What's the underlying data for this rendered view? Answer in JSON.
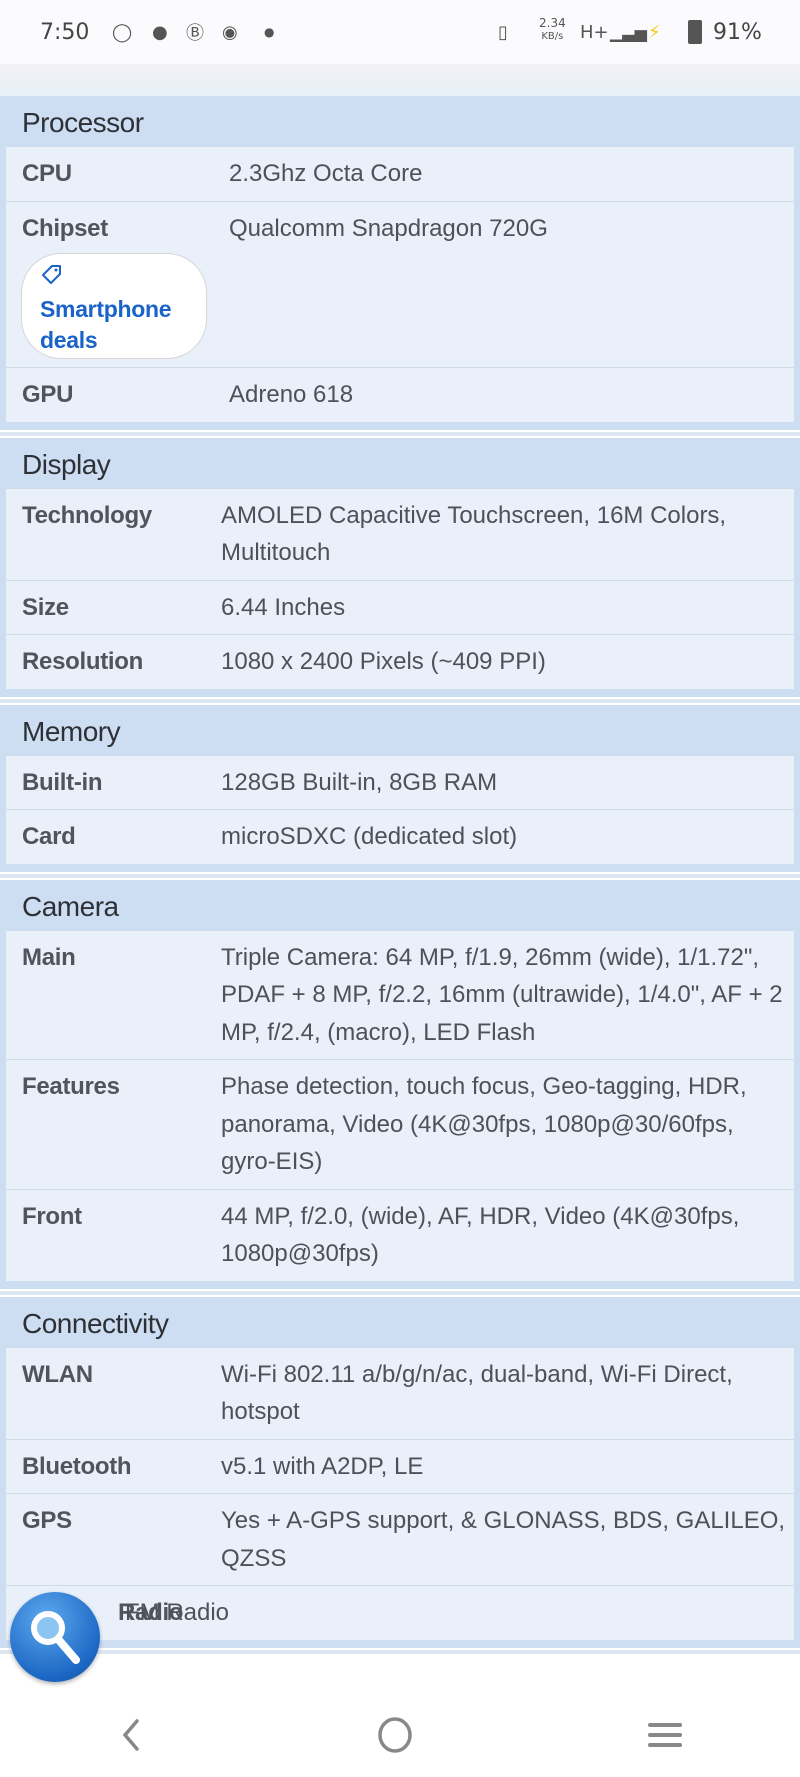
{
  "status_bar": {
    "time": "7:50",
    "notification_icons": [
      "whatsapp-icon",
      "messages-icon",
      "whatsapp-business-icon",
      "chrome-icon",
      "dot-icon"
    ],
    "net_speed": "2.34",
    "net_unit": "KB/s",
    "network": "H+",
    "battery": "91%"
  },
  "sections": [
    {
      "title": "Processor",
      "rows": [
        {
          "label": "CPU",
          "value": "2.3Ghz Octa Core"
        },
        {
          "label": "Chipset",
          "value": "Qualcomm Snapdragon 720G"
        },
        {
          "label": "GPU",
          "value": "Adreno 618"
        }
      ]
    },
    {
      "title": "Display",
      "rows": [
        {
          "label": "Technology",
          "value": "AMOLED Capacitive Touchscreen, 16M Colors, Multitouch"
        },
        {
          "label": "Size",
          "value": "6.44 Inches"
        },
        {
          "label": "Resolution",
          "value": "1080 x 2400 Pixels (~409 PPI)"
        }
      ]
    },
    {
      "title": "Memory",
      "rows": [
        {
          "label": "Built-in",
          "value": "128GB Built-in, 8GB RAM"
        },
        {
          "label": "Card",
          "value": "microSDXC (dedicated slot)"
        }
      ]
    },
    {
      "title": "Camera",
      "rows": [
        {
          "label": "Main",
          "value": "Triple Camera: 64 MP, f/1.9, 26mm (wide), 1/1.72\", PDAF + 8 MP, f/2.2, 16mm (ultrawide), 1/4.0\", AF + 2 MP, f/2.4, (macro), LED Flash"
        },
        {
          "label": "Features",
          "value": "Phase detection, touch focus, Geo-tagging, HDR, panorama, Video (4K@30fps, 1080p@30/60fps, gyro-EIS)"
        },
        {
          "label": "Front",
          "value": "44 MP, f/2.0, (wide), AF, HDR, Video (4K@30fps, 1080p@30fps)"
        }
      ]
    },
    {
      "title": "Connectivity",
      "rows": [
        {
          "label": "WLAN",
          "value": "Wi-Fi 802.11 a/b/g/n/ac, dual-band, Wi-Fi Direct, hotspot"
        },
        {
          "label": "Bluetooth",
          "value": "v5.1 with A2DP, LE"
        },
        {
          "label": "GPS",
          "value": "Yes + A-GPS support, & GLONASS, BDS, GALILEO, QZSS"
        },
        {
          "label": "Radio",
          "value": "FM Radio"
        }
      ]
    }
  ],
  "deals_button": {
    "label": "Smartphone deals",
    "accent": "#1a63c9"
  },
  "nav": {
    "back": "back-icon",
    "home": "home-icon",
    "recents": "recents-icon"
  }
}
